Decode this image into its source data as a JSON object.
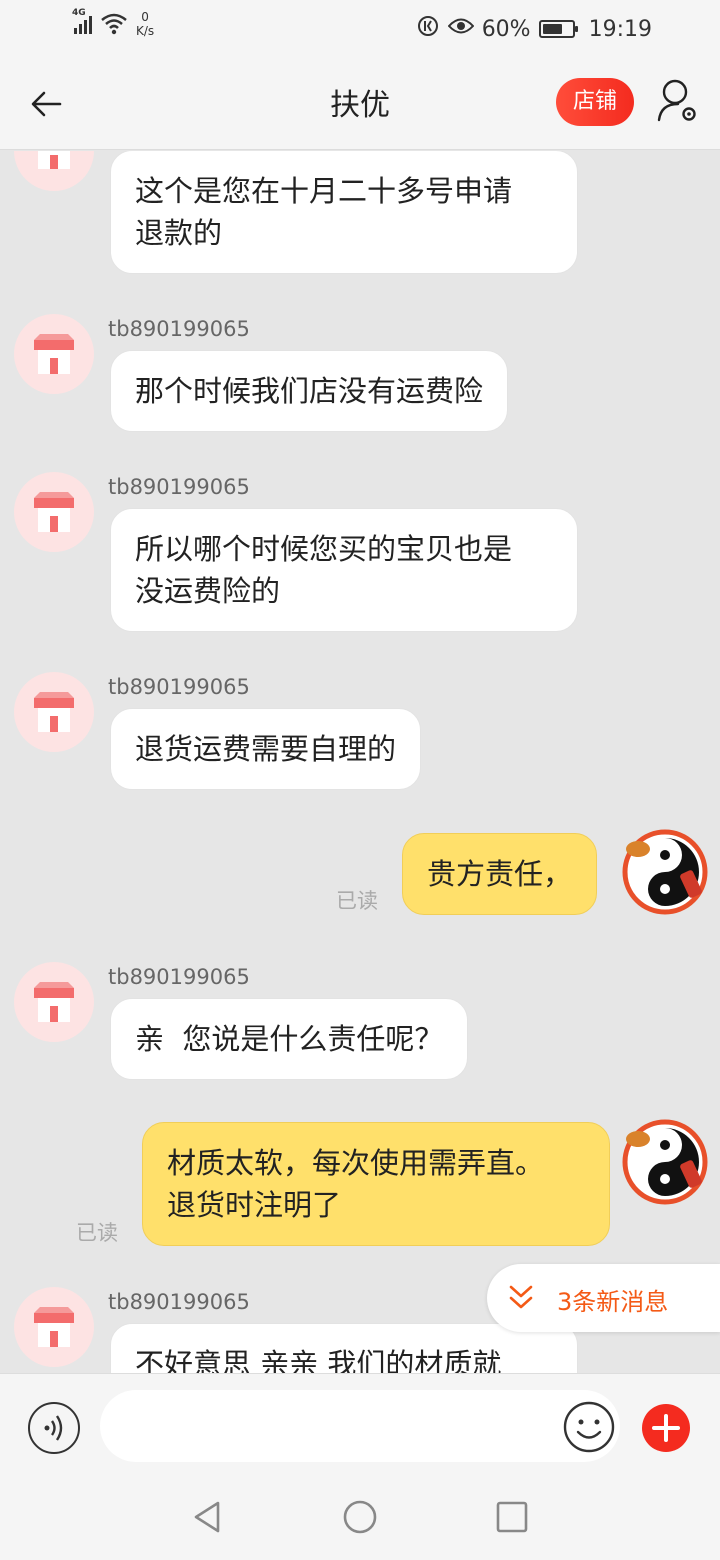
{
  "status_bar": {
    "network_label": "4G",
    "speed_value": "0",
    "speed_unit": "K/s",
    "battery": "60%",
    "time": "19:19"
  },
  "header": {
    "title": "扶优",
    "shop_button": "店铺"
  },
  "messages": [
    {
      "from": "shop",
      "sender": "",
      "lines": [
        "这个是您在十月二十多号申请",
        "退款的"
      ]
    },
    {
      "from": "shop",
      "sender": "tb890199065",
      "lines": [
        "那个时候我们店没有运费险"
      ]
    },
    {
      "from": "shop",
      "sender": "tb890199065",
      "lines": [
        "所以哪个时候您买的宝贝也是",
        "没运费险的"
      ]
    },
    {
      "from": "shop",
      "sender": "tb890199065",
      "lines": [
        "退货运费需要自理的"
      ]
    },
    {
      "from": "me",
      "status": "已读",
      "lines": [
        "贵方责任，"
      ]
    },
    {
      "from": "shop",
      "sender": "tb890199065",
      "lines": [
        "亲  您说是什么责任呢？"
      ]
    },
    {
      "from": "me",
      "status": "已读",
      "lines": [
        "材质太软，每次使用需弄直。",
        "退货时注明了"
      ]
    },
    {
      "from": "shop",
      "sender": "tb890199065",
      "lines": [
        "不好意思 亲亲 我们的材质就"
      ]
    }
  ],
  "new_messages": "3条新消息",
  "input": {
    "placeholder": ""
  },
  "colors": {
    "accent": "#f42b1f",
    "my_bubble": "#ffe06b",
    "new_msg_text": "#f45a16"
  }
}
